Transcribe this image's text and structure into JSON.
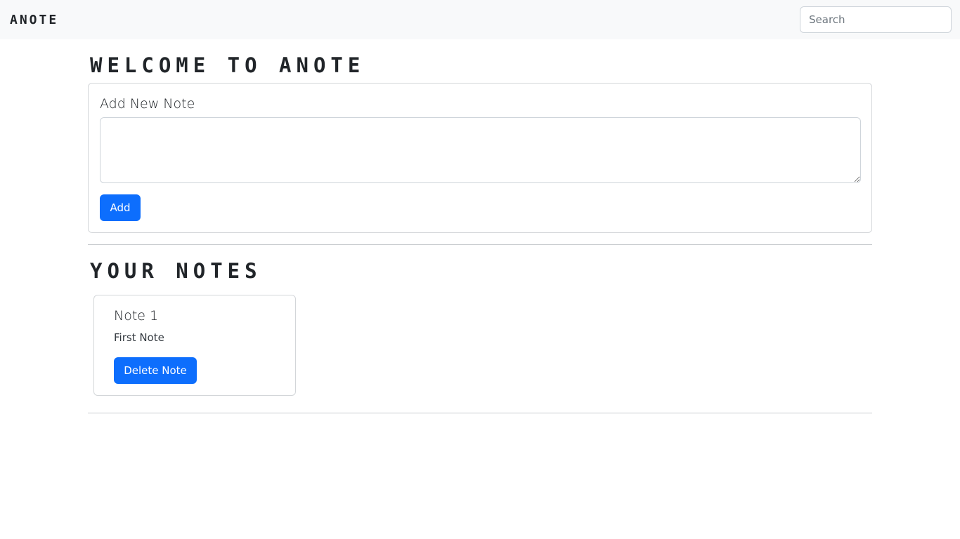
{
  "navbar": {
    "brand": "ANOTE",
    "search_placeholder": "Search"
  },
  "main": {
    "welcome_title": "WELCOME TO ANOTE",
    "add_note": {
      "label": "Add New Note",
      "textarea_value": "",
      "add_button_label": "Add"
    },
    "notes_title": "YOUR NOTES",
    "notes": [
      {
        "title": "Note 1",
        "text": "First Note",
        "delete_label": "Delete Note"
      }
    ]
  },
  "colors": {
    "primary": "#0d6efd",
    "navbar_bg": "#f8f9fa",
    "text": "#212529",
    "border": "#d3d6d9"
  }
}
